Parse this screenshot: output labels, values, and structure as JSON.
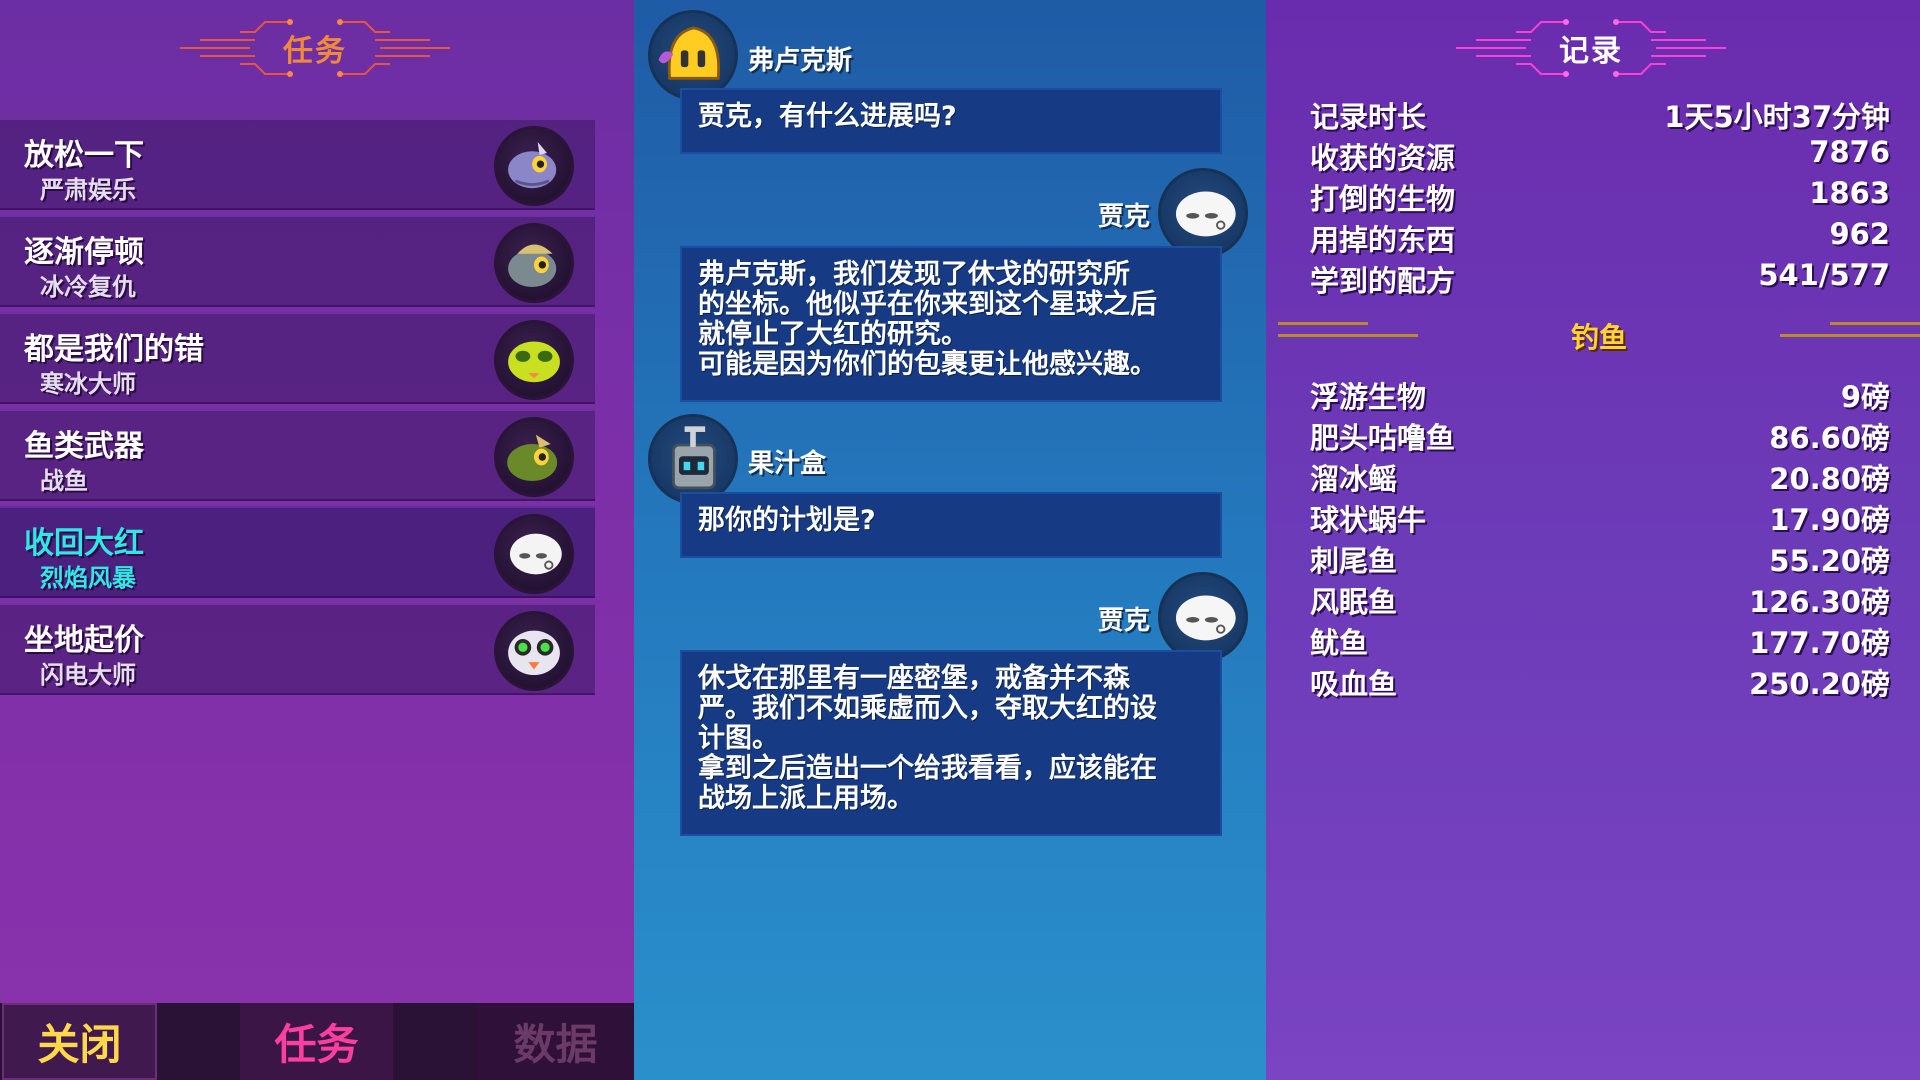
{
  "quests_panel": {
    "title": "任务",
    "items": [
      {
        "title": "放松一下",
        "subtitle": "严肃娱乐",
        "avatar": "gray-fish-creature-icon",
        "active": false
      },
      {
        "title": "逐渐停顿",
        "subtitle": "冰冷复仇",
        "avatar": "helmet-fish-creature-icon",
        "active": false
      },
      {
        "title": "都是我们的错",
        "subtitle": "寒冰大师",
        "avatar": "yellow-green-creature-icon",
        "active": false
      },
      {
        "title": "鱼类武器",
        "subtitle": "战鱼",
        "avatar": "green-fish-creature-icon",
        "active": false
      },
      {
        "title": "收回大红",
        "subtitle": "烈焰风暴",
        "avatar": "white-skull-creature-icon",
        "active": true
      },
      {
        "title": "坐地起价",
        "subtitle": "闪电大师",
        "avatar": "owl-creature-icon",
        "active": false
      }
    ]
  },
  "bottom_tabs": {
    "close": "关闭",
    "quests": "任务",
    "data": "数据"
  },
  "dialogue": [
    {
      "speaker": "弗卢克斯",
      "side": "left",
      "avatar": "yellow-mask-icon",
      "text": "贾克，有什么进展吗?"
    },
    {
      "speaker": "贾克",
      "side": "right",
      "avatar": "white-skull-icon",
      "text": "弗卢克斯，我们发现了休戈的研究所\n的坐标。他似乎在你来到这个星球之后\n就停止了大红的研究。\n可能是因为你们的包裹更让他感兴趣。"
    },
    {
      "speaker": "果汁盒",
      "side": "left",
      "avatar": "juicebox-robot-icon",
      "text": "那你的计划是?"
    },
    {
      "speaker": "贾克",
      "side": "right",
      "avatar": "white-skull-icon",
      "text": "休戈在那里有一座密堡，戒备并不森\n严。我们不如乘虚而入，夺取大红的设\n计图。\n拿到之后造出一个给我看看，应该能在\n战场上派上用场。"
    }
  ],
  "records_panel": {
    "title": "记录",
    "stats": [
      {
        "label": "记录时长",
        "value": "1天5小时37分钟"
      },
      {
        "label": "收获的资源",
        "value": "7876"
      },
      {
        "label": "打倒的生物",
        "value": "1863"
      },
      {
        "label": "用掉的东西",
        "value": "962"
      },
      {
        "label": "学到的配方",
        "value": "541/577"
      }
    ],
    "fishing_title": "钓鱼",
    "fishing": [
      {
        "label": "浮游生物",
        "value": "9磅"
      },
      {
        "label": "肥头咕噜鱼",
        "value": "86.60磅"
      },
      {
        "label": "溜冰鳐",
        "value": "20.80磅"
      },
      {
        "label": "球状蜗牛",
        "value": "17.90磅"
      },
      {
        "label": "刺尾鱼",
        "value": "55.20磅"
      },
      {
        "label": "风眠鱼",
        "value": "126.30磅"
      },
      {
        "label": "鱿鱼",
        "value": "177.70磅"
      },
      {
        "label": "吸血鱼",
        "value": "250.20磅"
      }
    ]
  },
  "colors": {
    "quest_header": "#f08a3a",
    "records_header": "#ffffff",
    "active_quest": "#31e6e6",
    "fishing_title": "#ffd23a"
  }
}
